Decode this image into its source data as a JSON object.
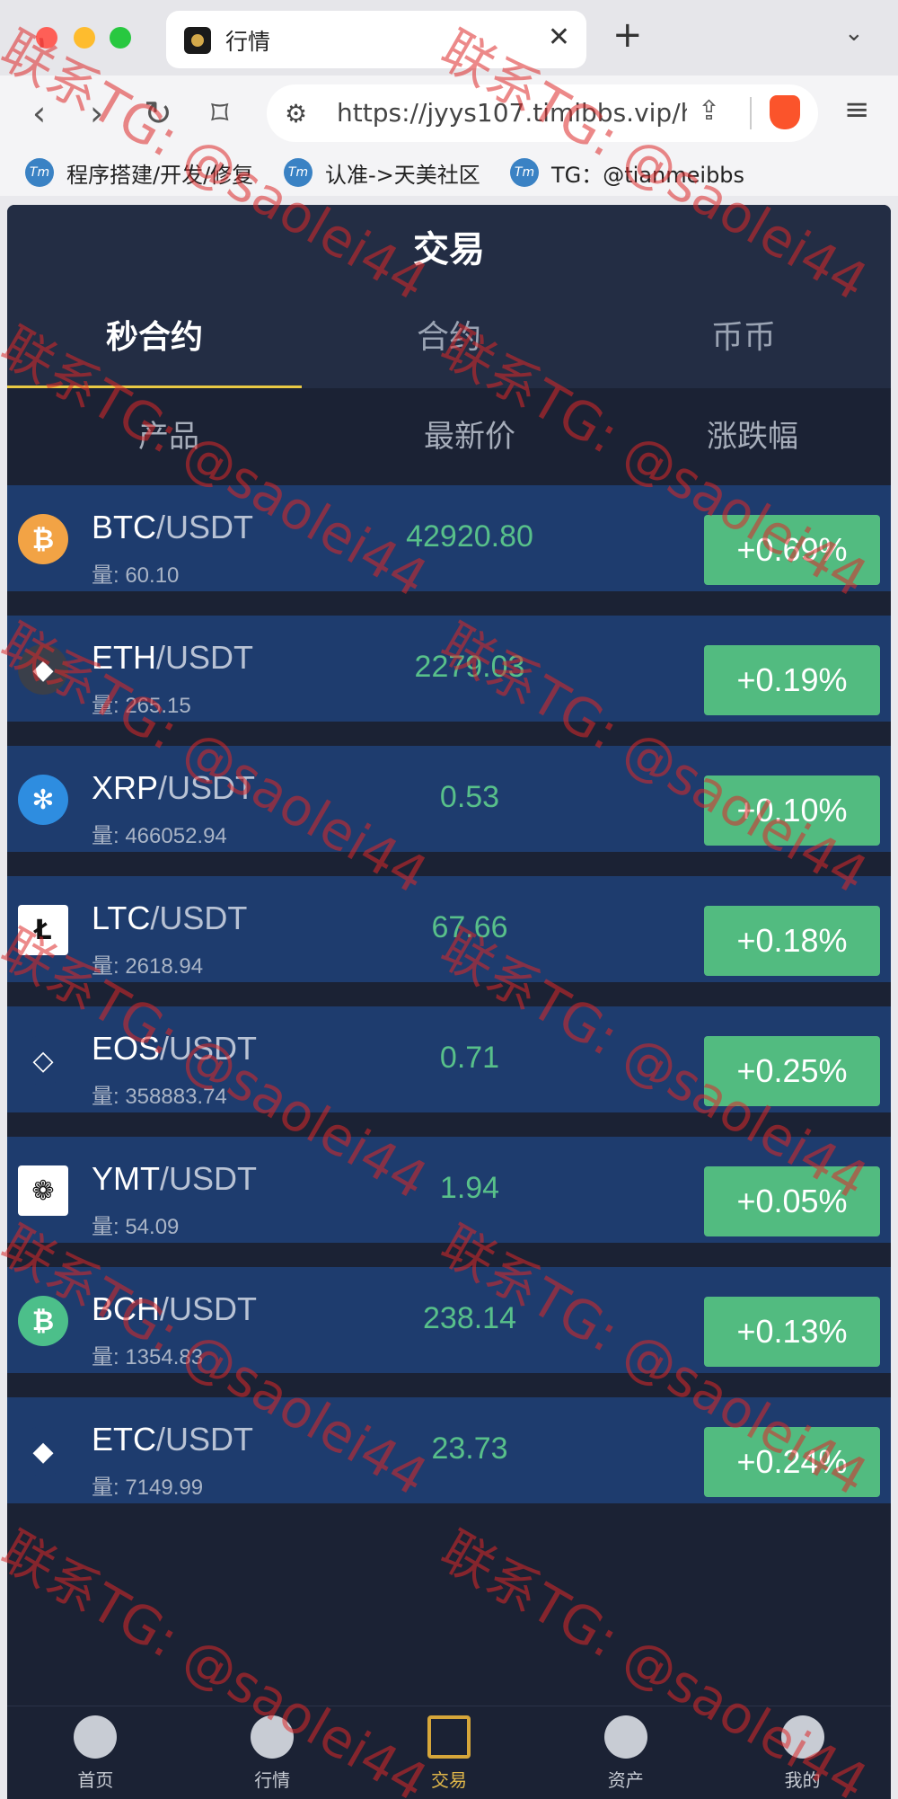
{
  "browser": {
    "tab_title": "行情",
    "tab_close": "✕",
    "new_tab": "+",
    "tab_menu": "⌄",
    "url": "https://jyys107.timibbs.vip/h...",
    "nav": {
      "back": "‹",
      "forward": "›",
      "reload": "↻",
      "bookmark": "⌑",
      "tune": "⚙",
      "share": "⇪",
      "menu": "≡"
    },
    "bookmarks": [
      {
        "label": "程序搭建/开发/修复",
        "icon": "Tm"
      },
      {
        "label": "认准->天美社区",
        "icon": "Tm"
      },
      {
        "label": "TG：@tianmeibbs",
        "icon": "Tm"
      }
    ]
  },
  "app": {
    "title": "交易",
    "tabs": [
      "秒合约",
      "合约",
      "币币"
    ],
    "active_tab": 0,
    "columns": [
      "产品",
      "最新价",
      "涨跌幅"
    ],
    "quote_suffix": "/USDT",
    "rows": [
      {
        "base": "BTC",
        "quote": "/USDT",
        "volume": "量: 60.10",
        "price": "42920.80",
        "change": "+0.69%",
        "icon": "bitcoin-icon",
        "icon_color": "#f2a345",
        "glyph": "₿"
      },
      {
        "base": "ETH",
        "quote": "/USDT",
        "volume": "量: 265.15",
        "price": "2279.03",
        "change": "+0.19%",
        "icon": "ethereum-icon",
        "icon_color": "#3a3f4a",
        "glyph": "◆"
      },
      {
        "base": "XRP",
        "quote": "/USDT",
        "volume": "量: 466052.94",
        "price": "0.53",
        "change": "+0.10%",
        "icon": "ripple-icon",
        "icon_color": "#2e8de0",
        "glyph": "✻"
      },
      {
        "base": "LTC",
        "quote": "/USDT",
        "volume": "量: 2618.94",
        "price": "67.66",
        "change": "+0.18%",
        "icon": "litecoin-icon",
        "icon_color": "#ffffff",
        "glyph": "Ł"
      },
      {
        "base": "EOS",
        "quote": "/USDT",
        "volume": "量: 358883.74",
        "price": "0.71",
        "change": "+0.25%",
        "icon": "eos-icon",
        "icon_color": "#1e3c6e",
        "glyph": "◇"
      },
      {
        "base": "YMT",
        "quote": "/USDT",
        "volume": "量: 54.09",
        "price": "1.94",
        "change": "+0.05%",
        "icon": "ymt-icon",
        "icon_color": "#ffffff",
        "glyph": "❁"
      },
      {
        "base": "BCH",
        "quote": "/USDT",
        "volume": "量: 1354.83",
        "price": "238.14",
        "change": "+0.13%",
        "icon": "bitcoin-cash-icon",
        "icon_color": "#4cbf8a",
        "glyph": "₿"
      },
      {
        "base": "ETC",
        "quote": "/USDT",
        "volume": "量: 7149.99",
        "price": "23.73",
        "change": "+0.24%",
        "icon": "ethereum-classic-icon",
        "icon_color": "#1e3c6e",
        "glyph": "◆"
      }
    ],
    "bottom_nav": [
      {
        "label": "首页",
        "icon": "home-icon"
      },
      {
        "label": "行情",
        "icon": "market-icon"
      },
      {
        "label": "交易",
        "icon": "trade-icon"
      },
      {
        "label": "资产",
        "icon": "wallet-icon"
      },
      {
        "label": "我的",
        "icon": "profile-icon"
      }
    ],
    "active_nav": 2
  },
  "watermark": "联系TG: @saolei44",
  "colors": {
    "positive": "#52bb80",
    "price_green": "#58c08a",
    "accent": "#e8c944",
    "row_bg": "#1e3c6e",
    "app_bg": "#1b2234"
  }
}
